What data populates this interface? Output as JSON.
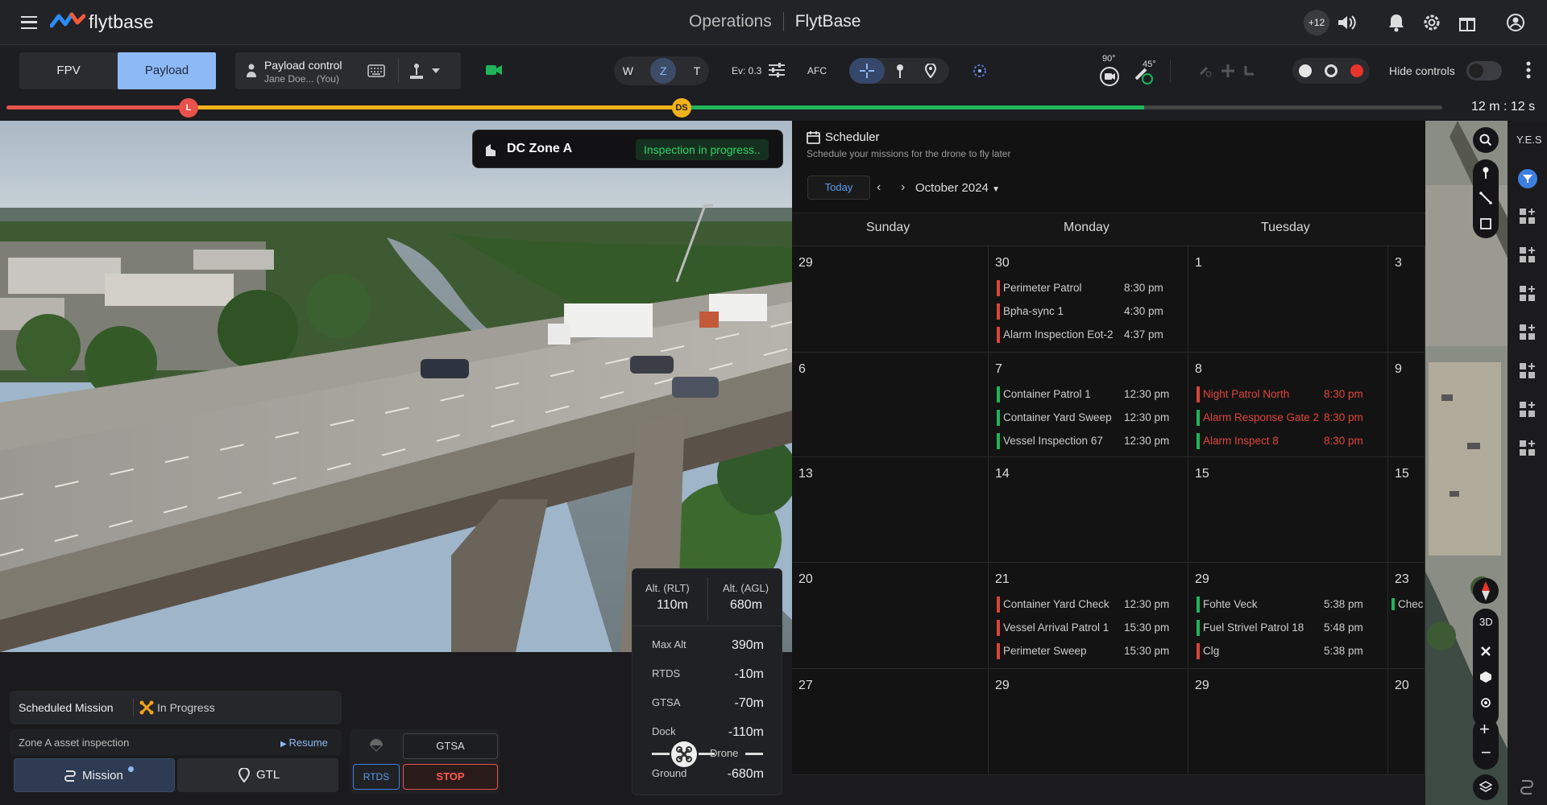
{
  "header": {
    "logo_text": "flytbase",
    "section": "Operations",
    "brand": "FlytBase",
    "badge": "+12"
  },
  "controls": {
    "tab_fpv": "FPV",
    "tab_payload": "Payload",
    "payload_control_title": "Payload control",
    "payload_control_user": "Jane Doe... (You)",
    "zoom_w": "W",
    "zoom_z": "Z",
    "zoom_t": "T",
    "ev_label": "Ev: 0.3",
    "afc_label": "AFC",
    "gimbal_pitch": "90°",
    "gimbal_yaw": "45°",
    "hide_controls": "Hide controls",
    "accent": "#8db9f4"
  },
  "timeline": {
    "marker_l": "L",
    "marker_ds": "DS",
    "time_remaining": "12 m : 12 s"
  },
  "video": {
    "zone_name": "DC Zone A",
    "zone_status": "Inspection in progress.."
  },
  "mission": {
    "scheduled_label": "Scheduled Mission",
    "status": "In Progress",
    "asset": "Zone A asset inspection",
    "resume": "Resume",
    "mission_btn": "Mission",
    "gtl_btn": "GTL",
    "gtsa_btn": "GTSA",
    "rtds_btn": "RTDS",
    "stop_btn": "STOP"
  },
  "altitude": {
    "rlt_label": "Alt. (RLT)",
    "rlt_value": "110m",
    "agl_label": "Alt. (AGL)",
    "agl_value": "680m",
    "rows": [
      {
        "k": "Max Alt",
        "v": "390m"
      },
      {
        "k": "RTDS",
        "v": "-10m"
      },
      {
        "k": "GTSA",
        "v": "-70m"
      },
      {
        "k": "Dock",
        "v": "-110m"
      },
      {
        "k": "Ground",
        "v": "-680m"
      }
    ],
    "drone_label": "Drone"
  },
  "scheduler": {
    "title": "Scheduler",
    "subtitle": "Schedule your missions for the drone to fly later",
    "today": "Today",
    "month": "October 2024",
    "days": [
      "Sunday",
      "Monday",
      "Tuesday"
    ],
    "weeks": [
      {
        "sun": "29",
        "mon": "30",
        "tue": "1",
        "wed": "3"
      },
      {
        "sun": "6",
        "mon": "7",
        "tue": "8",
        "wed": "9"
      },
      {
        "sun": "13",
        "mon": "14",
        "tue": "15",
        "wed": "15"
      },
      {
        "sun": "20",
        "mon": "21",
        "tue": "29",
        "wed": "23"
      },
      {
        "sun": "27",
        "mon": "29",
        "tue": "29",
        "wed": "20"
      }
    ],
    "events": {
      "w0_mon": [
        {
          "name": "Perimeter Patrol",
          "time": "8:30 pm",
          "color": "red"
        },
        {
          "name": "Bpha-sync 1",
          "time": "4:30 pm",
          "color": "red"
        },
        {
          "name": "Alarm Inspection Eot-2",
          "time": "4:37 pm",
          "color": "red"
        }
      ],
      "w1_mon": [
        {
          "name": "Container Patrol 1",
          "time": "12:30 pm",
          "color": "grn"
        },
        {
          "name": "Container Yard Sweep",
          "time": "12:30 pm",
          "color": "grn"
        },
        {
          "name": "Vessel Inspection 67",
          "time": "12:30 pm",
          "color": "grn"
        }
      ],
      "w1_tue": [
        {
          "name": "Night Patrol North",
          "time": "8:30 pm",
          "color": "red"
        },
        {
          "name": "Alarm Response Gate 2",
          "time": "8:30 pm",
          "color": "grn"
        },
        {
          "name": "Alarm Inspect 8",
          "time": "8:30 pm",
          "color": "grn"
        }
      ],
      "w3_mon": [
        {
          "name": "Container Yard Check",
          "time": "12:30 pm",
          "color": "red"
        },
        {
          "name": "Vessel Arrival Patrol 1",
          "time": "15:30 pm",
          "color": "red"
        },
        {
          "name": "Perimeter Sweep",
          "time": "15:30 pm",
          "color": "red"
        }
      ],
      "w3_tue": [
        {
          "name": "Fohte Veck",
          "time": "5:38 pm",
          "color": "grn"
        },
        {
          "name": "Fuel Strivel Patrol 18",
          "time": "5:48 pm",
          "color": "grn"
        },
        {
          "name": "Clg",
          "time": "5:38 pm",
          "color": "red"
        }
      ],
      "w3_wed": [
        {
          "name": "Chec",
          "time": "",
          "color": "grn"
        }
      ]
    }
  },
  "map": {
    "view_3d": "3D",
    "side_label": "Y.E.S"
  }
}
